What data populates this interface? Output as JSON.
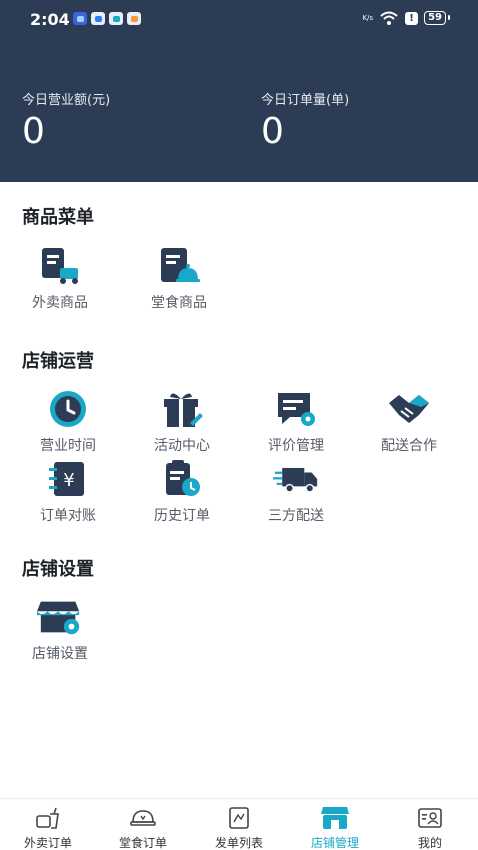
{
  "status_bar": {
    "time": "2:04",
    "speed": "K/s",
    "battery": "59"
  },
  "stats": {
    "revenue_label": "今日营业额(元)",
    "revenue_value": "0",
    "orders_label": "今日订单量(单)",
    "orders_value": "0"
  },
  "sections": {
    "menu": {
      "title": "商品菜单",
      "items": [
        {
          "label": "外卖商品",
          "icon": "takeout-goods-icon"
        },
        {
          "label": "堂食商品",
          "icon": "dine-in-goods-icon"
        }
      ]
    },
    "operations": {
      "title": "店铺运营",
      "items": [
        {
          "label": "营业时间",
          "icon": "clock-icon"
        },
        {
          "label": "活动中心",
          "icon": "gift-icon"
        },
        {
          "label": "评价管理",
          "icon": "review-icon"
        },
        {
          "label": "配送合作",
          "icon": "handshake-icon"
        },
        {
          "label": "订单对账",
          "icon": "reconcile-icon"
        },
        {
          "label": "历史订单",
          "icon": "history-order-icon"
        },
        {
          "label": "三方配送",
          "icon": "delivery-truck-icon"
        }
      ]
    },
    "settings": {
      "title": "店铺设置",
      "items": [
        {
          "label": "店铺设置",
          "icon": "store-settings-icon"
        }
      ]
    }
  },
  "tabbar": {
    "active_color": "#1aa8c9",
    "items": [
      {
        "label": "外卖订单",
        "icon": "takeout-order-icon"
      },
      {
        "label": "堂食订单",
        "icon": "dine-in-order-icon"
      },
      {
        "label": "发单列表",
        "icon": "dispatch-list-icon"
      },
      {
        "label": "店铺管理",
        "icon": "store-manage-icon",
        "active": true
      },
      {
        "label": "我的",
        "icon": "profile-icon"
      }
    ]
  },
  "colors": {
    "header_bg": "#2b3c54",
    "icon_dark": "#2b3c54",
    "accent": "#1aa8c9"
  }
}
